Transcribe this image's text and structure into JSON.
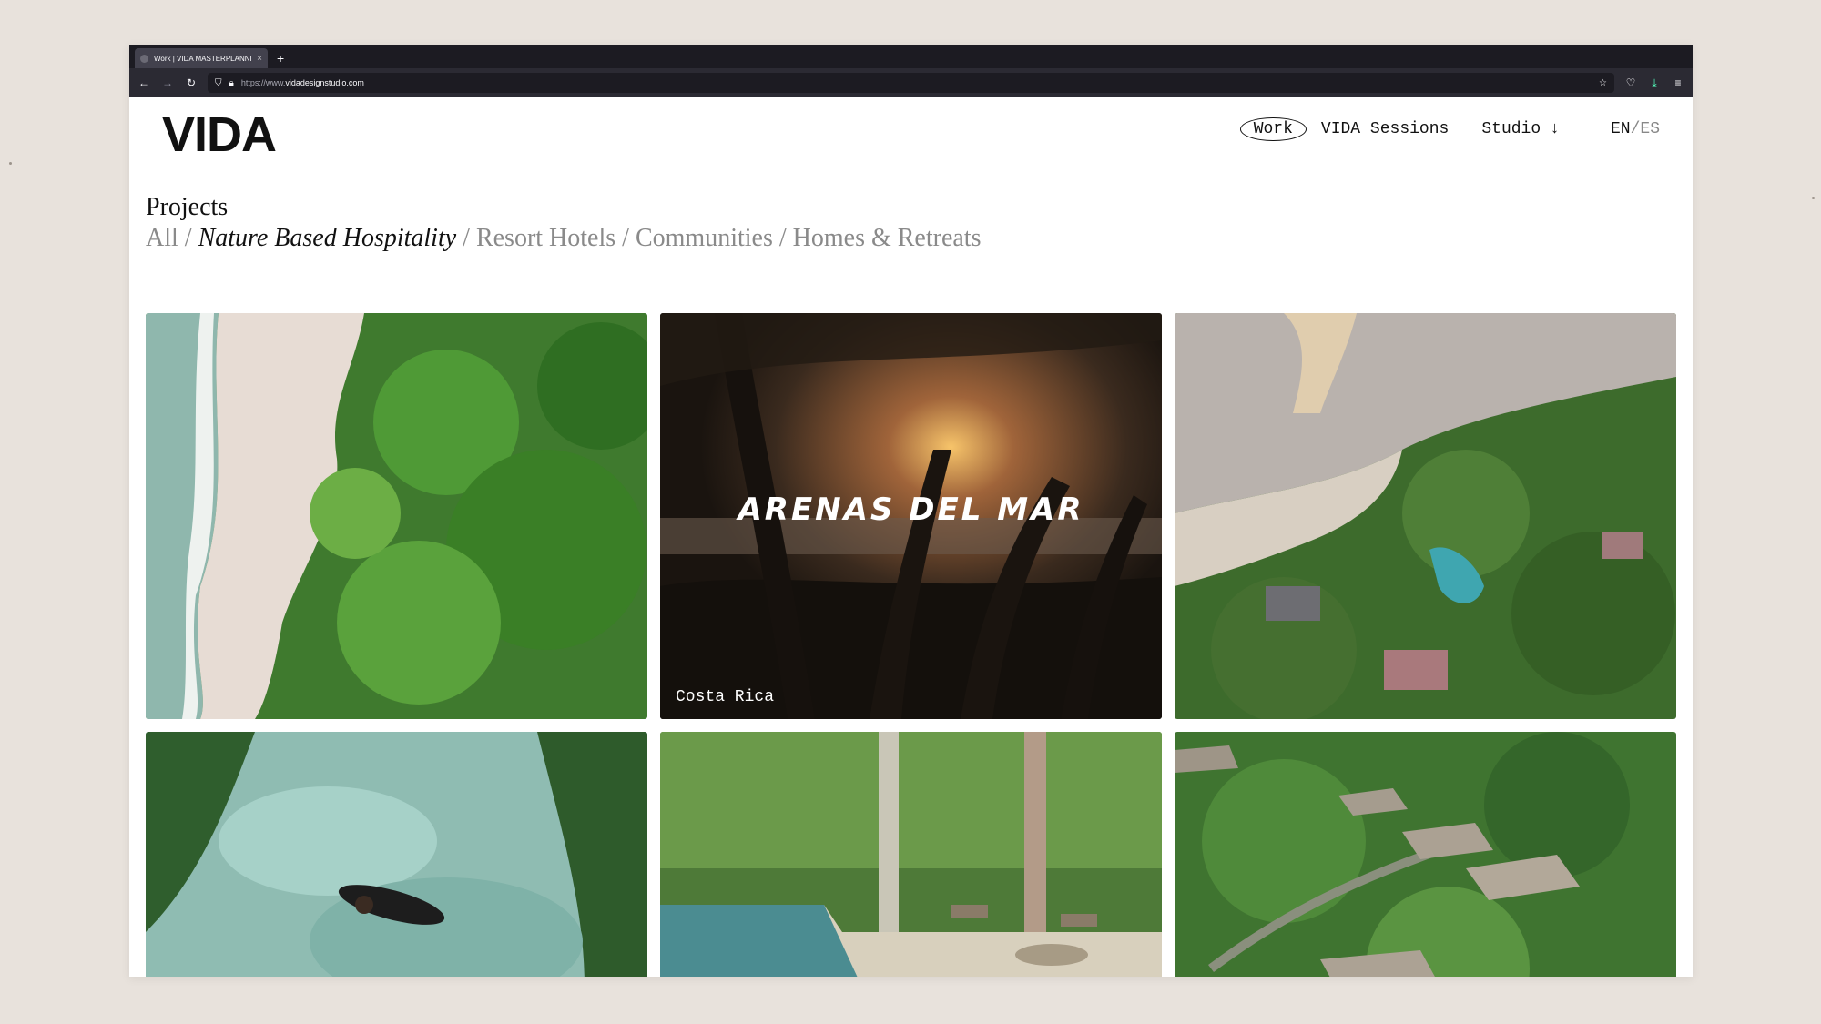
{
  "browser": {
    "tab_title": "Work | VIDA MASTERPLANNING",
    "tab_close": "×",
    "new_tab": "+",
    "url_prefix": "https://www.",
    "url_domain": "vidadesignstudio.com"
  },
  "site": {
    "logo": "VIDA",
    "nav": {
      "work": "Work",
      "sessions": "VIDA Sessions",
      "studio": "Studio",
      "lang_en": "EN",
      "lang_sep": "/",
      "lang_es": "ES"
    }
  },
  "projects": {
    "title": "Projects",
    "filters": {
      "all": "All",
      "nature": "Nature Based Hospitality",
      "resort": "Resort Hotels",
      "communities": "Communities",
      "homes": "Homes & Retreats",
      "separator": " / "
    }
  },
  "cards": [
    {
      "image": "aerial beach and jungle"
    },
    {
      "image": "sunset through trees with hammock",
      "title": "ARENAS DEL MAR",
      "location": "Costa Rica"
    },
    {
      "image": "coastal resort aerial at sunset"
    },
    {
      "image": "swimmer in turquoise water"
    },
    {
      "image": "jungle pool terrace"
    },
    {
      "image": "tented villas in rainforest"
    }
  ]
}
